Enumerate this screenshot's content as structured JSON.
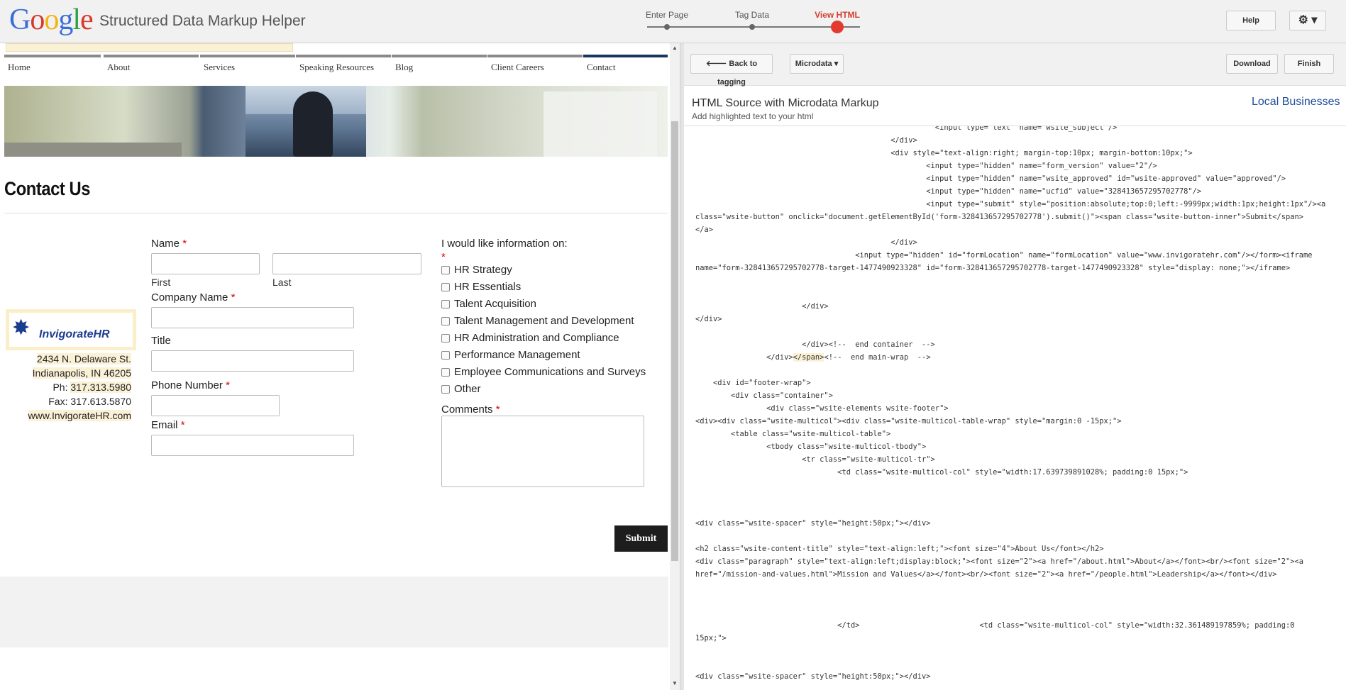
{
  "topbar": {
    "logo_letters": [
      {
        "ch": "G",
        "color": "#3b6fd8"
      },
      {
        "ch": "o",
        "color": "#d8392b"
      },
      {
        "ch": "o",
        "color": "#f2b50f"
      },
      {
        "ch": "g",
        "color": "#3b6fd8"
      },
      {
        "ch": "l",
        "color": "#2f9e44"
      },
      {
        "ch": "e",
        "color": "#d8392b"
      }
    ],
    "app_title": "Structured Data Markup Helper",
    "steps": [
      "Enter Page",
      "Tag Data",
      "View HTML"
    ],
    "active_step": "View HTML",
    "help_label": "Help",
    "settings_icon": "gear-icon",
    "settings_glyph": "⚙ ▾"
  },
  "site": {
    "nav": [
      "Home",
      "About",
      "Services",
      "Speaking Resources",
      "Blog",
      "Client Careers",
      "Contact"
    ],
    "active_nav": "Contact",
    "heading": "Contact Us",
    "logo_mark": "✸",
    "logo_brand": "InvigorateHR",
    "address_lines": [
      "2434 N. Delaware St.",
      "Indianapolis, IN  46205"
    ],
    "phone_prefix": "Ph: ",
    "phone": "317.313.5980",
    "fax": "Fax: 317.613.5870",
    "website": "www.InvigorateHR.com",
    "form": {
      "name_label": "Name",
      "first_label": "First",
      "last_label": "Last",
      "company_label": "Company Name",
      "title_label": "Title",
      "phone_label": "Phone Number",
      "email_label": "Email",
      "required_mark": "*",
      "info_label": "I would like information on:",
      "options": [
        "HR Strategy",
        "HR Essentials",
        "Talent Acquisition",
        "Talent Management and Development",
        "HR Administration and Compliance",
        "Performance Management",
        "Employee Communications and Surveys",
        "Other"
      ],
      "comments_label": "Comments",
      "submit_label": "Submit"
    }
  },
  "panel": {
    "back_label": "🡐 Back to tagging",
    "microdata_label": "Microdata ▾",
    "download_label": "Download",
    "finish_label": "Finish",
    "source_title": "HTML Source with Microdata Markup",
    "source_subtitle": "Add highlighted text to your html",
    "schema_type": "Local Businesses",
    "code_lines": [
      "                                                      <input type=\"text\" name=\"wsite_subject\"/>",
      "                                            </div>",
      "                                            <div style=\"text-align:right; margin-top:10px; margin-bottom:10px;\">",
      "                                                    <input type=\"hidden\" name=\"form_version\" value=\"2\"/>",
      "                                                    <input type=\"hidden\" name=\"wsite_approved\" id=\"wsite-approved\" value=\"approved\"/>",
      "                                                    <input type=\"hidden\" name=\"ucfid\" value=\"328413657295702778\"/>",
      "                                                    <input type=\"submit\" style=\"position:absolute;top:0;left:-9999px;width:1px;height:1px\"/><a",
      "class=\"wsite-button\" onclick=\"document.getElementById('form-328413657295702778').submit()\"><span class=\"wsite-button-inner\">Submit</span>",
      "</a>",
      "                                            </div>",
      "                                    <input type=\"hidden\" id=\"formLocation\" name=\"formLocation\" value=\"www.invigoratehr.com\"/></form><iframe",
      "name=\"form-328413657295702778-target-1477490923328\" id=\"form-328413657295702778-target-1477490923328\" style=\"display: none;\"></iframe>",
      "",
      "",
      "                        </div>",
      "</div>",
      "",
      "                        </div><!--  end container  -->",
      "                </div></span><!--  end main-wrap  -->",
      "",
      "    <div id=\"footer-wrap\">",
      "        <div class=\"container\">",
      "                <div class=\"wsite-elements wsite-footer\">",
      "<div><div class=\"wsite-multicol\"><div class=\"wsite-multicol-table-wrap\" style=\"margin:0 -15px;\">",
      "        <table class=\"wsite-multicol-table\">",
      "                <tbody class=\"wsite-multicol-tbody\">",
      "                        <tr class=\"wsite-multicol-tr\">",
      "                                <td class=\"wsite-multicol-col\" style=\"width:17.639739891028%; padding:0 15px;\">",
      "",
      "",
      "",
      "<div class=\"wsite-spacer\" style=\"height:50px;\"></div>",
      "",
      "<h2 class=\"wsite-content-title\" style=\"text-align:left;\"><font size=\"4\">About Us</font></h2>",
      "<div class=\"paragraph\" style=\"text-align:left;display:block;\"><font size=\"2\"><a href=\"/about.html\">About</a></font><br/><font size=\"2\"><a",
      "href=\"/mission-and-values.html\">Mission and Values</a></font><br/><font size=\"2\"><a href=\"/people.html\">Leadership</a></font></div>",
      "",
      "",
      "",
      "                                </td>                           <td class=\"wsite-multicol-col\" style=\"width:32.361489197859%; padding:0",
      "15px;\">",
      "",
      "",
      "<div class=\"wsite-spacer\" style=\"height:50px;\"></div>"
    ]
  }
}
